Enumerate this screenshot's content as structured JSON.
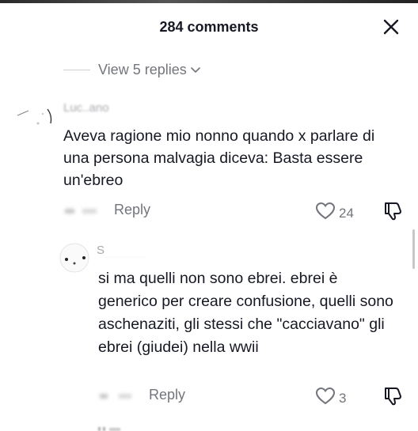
{
  "header": {
    "title": "284 comments",
    "close_icon": "close-icon"
  },
  "thread": {
    "view_replies_label": "View 5 replies",
    "chevron_icon": "chevron-down-icon"
  },
  "comments": [
    {
      "username": "Luc..ano",
      "text": "Aveva ragione mio nonno quando x parlare di una persona malvagia diceva: Basta essere un'ebreo",
      "reply_label": "Reply",
      "likes": "24",
      "like_icon": "heart-outline-icon",
      "dislike_icon": "thumbs-down-icon"
    },
    {
      "username": "S",
      "text": "si ma quelli non sono ebrei. ebrei è generico per creare confusione, quelli sono aschenaziti, gli stessi che \"cacciavano\" gli ebrei (giudei) nella wwii",
      "reply_label": "Reply",
      "likes": "3",
      "like_icon": "heart-outline-icon",
      "dislike_icon": "thumbs-down-icon"
    }
  ],
  "colors": {
    "text_primary": "#161823",
    "text_secondary": "#73757c",
    "divider": "#d0d0d3"
  }
}
